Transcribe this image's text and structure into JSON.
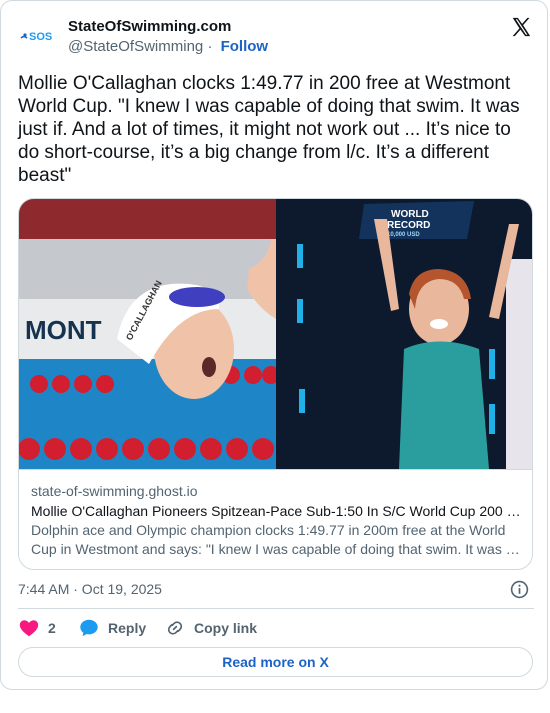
{
  "author": {
    "name": "StateOfSwimming.com",
    "handle": "@StateOfSwimming",
    "separator": "·",
    "follow_label": "Follow",
    "avatar_text": "SOS"
  },
  "tweet": {
    "text": "Mollie O'Callaghan clocks 1:49.77 in 200 free at Westmont World Cup. \"I knew I was capable of doing that swim. It was just if. And a lot of times, it might not work out ... It’s nice to do short-course, it’s a big change from l/c. It’s a different beast\""
  },
  "media": {
    "left_cap_name": "O'CALLAGHAN",
    "sign_line1": "WORLD",
    "sign_line2": "RECORD",
    "sign_line3": "10,000 USD",
    "banner_text": "MONT"
  },
  "link_card": {
    "domain": "state-of-swimming.ghost.io",
    "title": "Mollie O'Callaghan Pioneers Spitzean-Pace Sub-1:50 In S/C World Cup 200 …",
    "description": "Dolphin ace and Olympic champion clocks 1:49.77 in 200m free at the World Cup in Westmont and says: \"I knew I was capable of doing that swim. It was …"
  },
  "timestamp": "7:44 AM · Oct 19, 2025",
  "actions": {
    "likes_count": "2",
    "reply_label": "Reply",
    "copy_label": "Copy link"
  },
  "read_more_label": "Read more on X",
  "colors": {
    "accent": "#1d63c5",
    "like": "#f91880",
    "reply": "#1d9bf0"
  },
  "icons": [
    "x-logo-icon",
    "info-icon",
    "heart-icon",
    "reply-bubble-icon",
    "link-icon"
  ]
}
